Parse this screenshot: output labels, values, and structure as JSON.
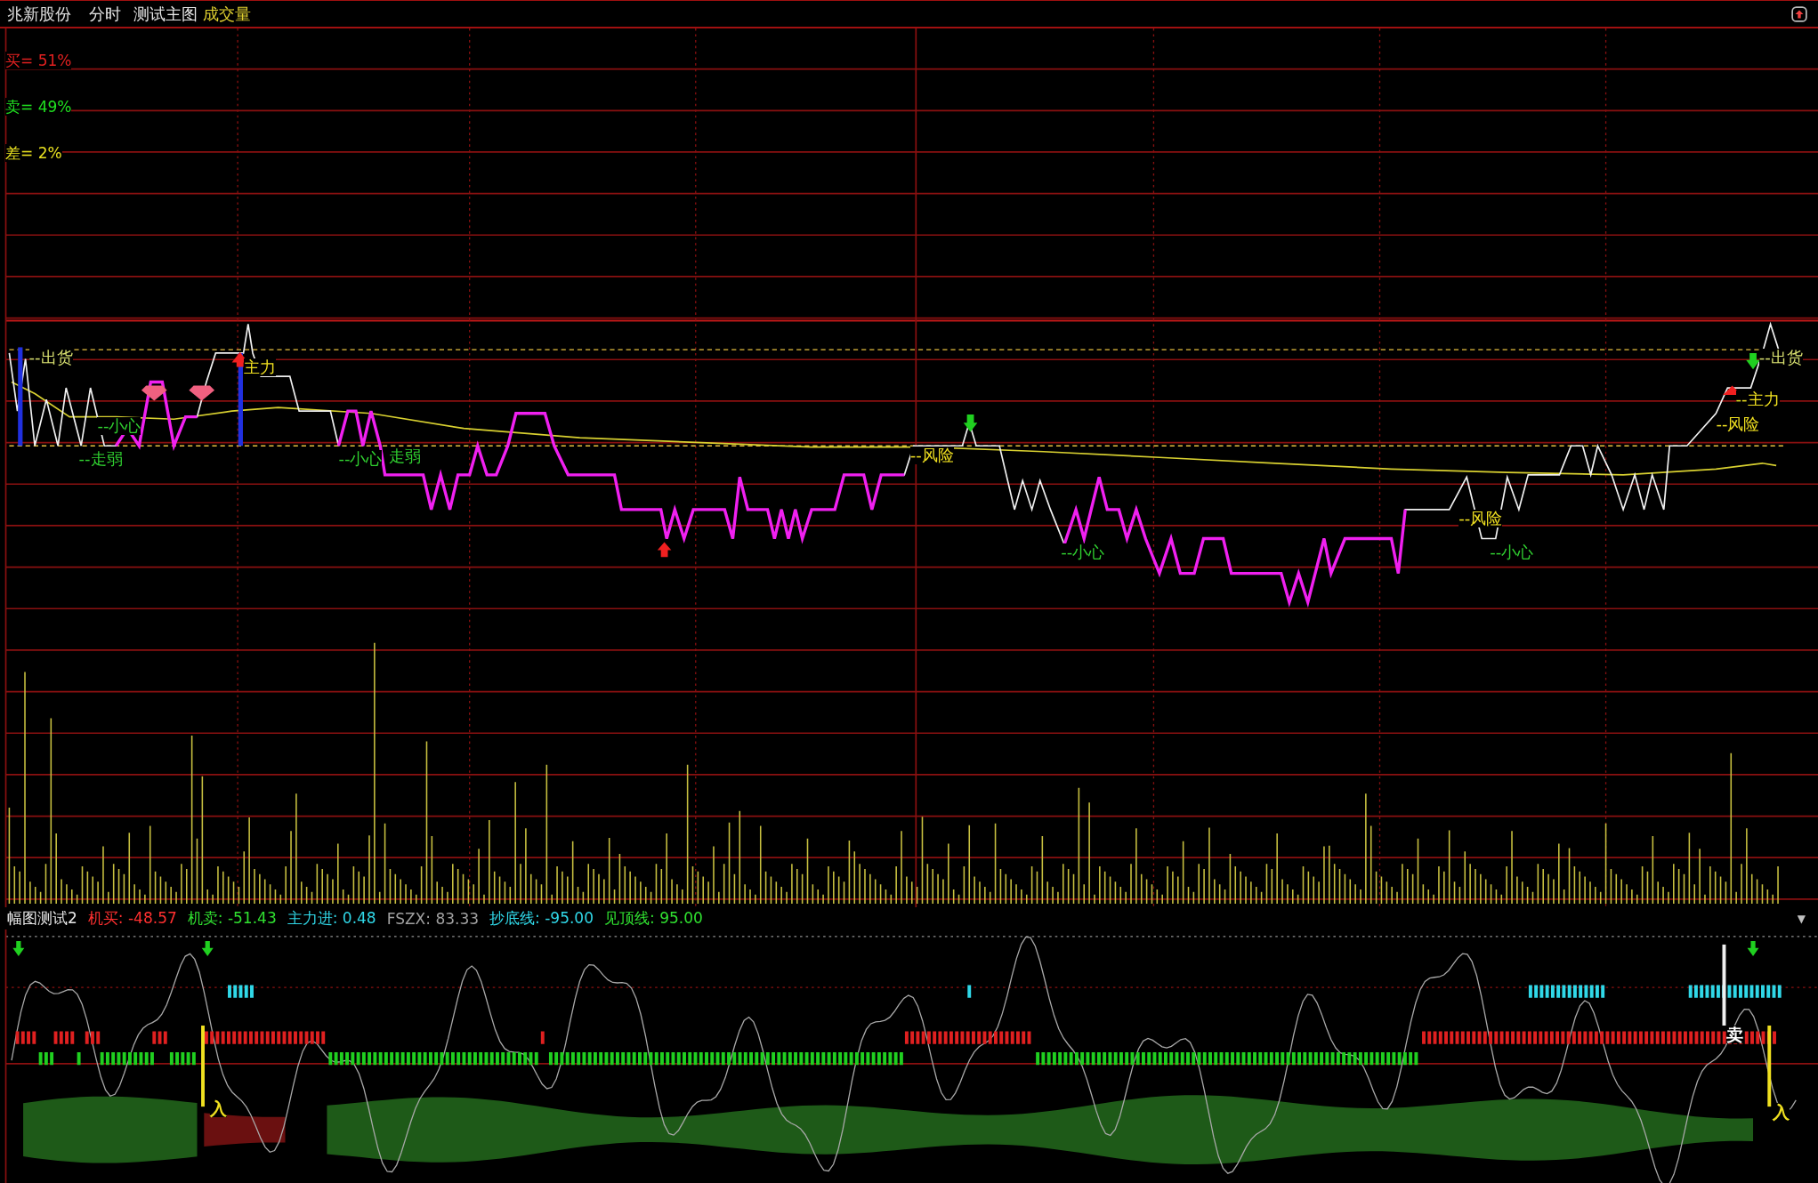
{
  "header": {
    "stock_name": "兆新股份",
    "view": "分时",
    "main_indicator": "测试主图",
    "sub_indicator": "成交量"
  },
  "ratios": [
    {
      "text": "买= 51%",
      "color": "#e02020"
    },
    {
      "text": "卖= 49%",
      "color": "#20e020"
    },
    {
      "text": "差= 2%",
      "color": "#e8e020"
    }
  ],
  "chart_labels": [
    {
      "text": "--出货",
      "color": "#d8e070"
    },
    {
      "text": "主力",
      "color": "#f0e020"
    },
    {
      "text": "--小心",
      "color": "#30d030"
    },
    {
      "text": "--走弱",
      "color": "#30d030"
    },
    {
      "text": "--小心",
      "color": "#30d030"
    },
    {
      "text": "走弱",
      "color": "#30d030"
    },
    {
      "text": "--风险",
      "color": "#f0e020"
    },
    {
      "text": "--小心",
      "color": "#30d030"
    },
    {
      "text": "--风险",
      "color": "#f0e020"
    },
    {
      "text": "--小心",
      "color": "#30d030"
    },
    {
      "text": "--出货",
      "color": "#d8e070"
    },
    {
      "text": "--主力",
      "color": "#f0e020"
    },
    {
      "text": "--风险",
      "color": "#f0e020"
    }
  ],
  "indicator_bar": {
    "name": "幅图测试2",
    "values": [
      {
        "text": "机买: -48.57",
        "color": "#ff3030"
      },
      {
        "text": "机卖: -51.43",
        "color": "#30e030"
      },
      {
        "text": "主力进: 0.48",
        "color": "#30d8e8"
      },
      {
        "text": "FSZX: 83.33",
        "color": "#a0a0a0"
      },
      {
        "text": "抄底线: -95.00",
        "color": "#30d8e8"
      },
      {
        "text": "见顶线: 95.00",
        "color": "#30e030"
      }
    ],
    "menu_caret": "▼"
  },
  "lower_labels": [
    {
      "text": "入",
      "color": "#f0e020"
    },
    {
      "text": "入",
      "color": "#f0e020"
    },
    {
      "text": "卖",
      "color": "#ffffff"
    }
  ]
}
